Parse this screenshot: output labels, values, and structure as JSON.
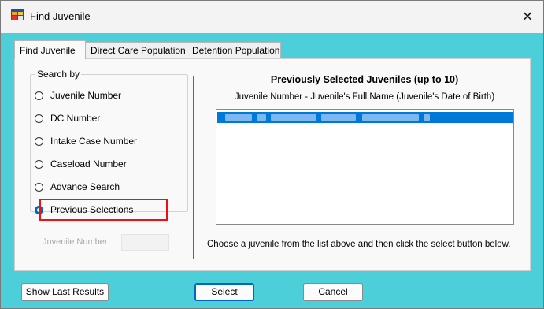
{
  "window": {
    "title": "Find Juvenile",
    "close_glyph": "✕",
    "icon": "app-form-icon",
    "background_color": "#4ccfd8"
  },
  "tabs": [
    {
      "label": "Find Juvenile",
      "active": true
    },
    {
      "label": "Direct Care Population",
      "active": false
    },
    {
      "label": "Detention Population",
      "active": false
    }
  ],
  "search_by": {
    "legend": "Search by",
    "options": [
      {
        "label": "Juvenile Number",
        "checked": false
      },
      {
        "label": "DC Number",
        "checked": false
      },
      {
        "label": "Intake Case Number",
        "checked": false
      },
      {
        "label": "Caseload Number",
        "checked": false
      },
      {
        "label": "Advance Search",
        "checked": false
      },
      {
        "label": "Previous Selections",
        "checked": true
      }
    ]
  },
  "juvenile_number": {
    "label": "Juvenile Number",
    "value": ""
  },
  "previous": {
    "title": "Previously Selected Juveniles (up to 10)",
    "subtitle": "Juvenile Number - Juvenile's Full Name (Juvenile's Date of Birth)",
    "selected_item": "",
    "instructions": "Choose a juvenile from the list above and then click the select button below."
  },
  "buttons": {
    "show_last_results": "Show Last Results",
    "select": "Select",
    "cancel": "Cancel"
  },
  "colors": {
    "selection": "#0078d7",
    "highlight_border": "#e11111",
    "accent": "#0067c0"
  }
}
